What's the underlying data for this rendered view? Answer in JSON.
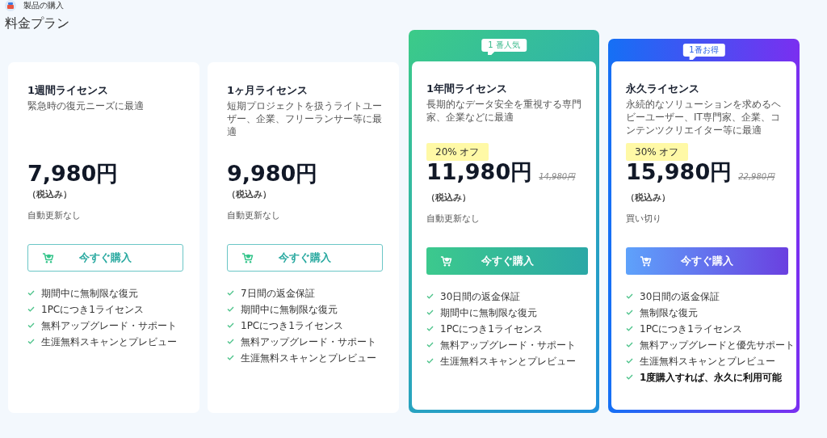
{
  "header": {
    "breadcrumb": "製品の購入",
    "title": "料金プラン"
  },
  "plans": [
    {
      "kind": "plain",
      "name": "1週間ライセンス",
      "description": "緊急時の復元ニーズに最適",
      "price": "7,980円",
      "tax_note": "（税込み）",
      "renewal": "自動更新なし",
      "button": "今すぐ購入",
      "features": [
        {
          "text": "期間中に無制限な復元",
          "bold": false
        },
        {
          "text": "1PCにつき1ライセンス",
          "bold": false
        },
        {
          "text": "無料アップグレード・サポート",
          "bold": false
        },
        {
          "text": "生涯無料スキャンとプレビュー",
          "bold": false
        }
      ]
    },
    {
      "kind": "plain",
      "name": "1ヶ月ライセンス",
      "description": "短期プロジェクトを扱うライトユーザー、企業、フリーランサー等に最適",
      "price": "9,980円",
      "tax_note": "（税込み）",
      "renewal": "自動更新なし",
      "button": "今すぐ購入",
      "features": [
        {
          "text": "7日間の返金保証",
          "bold": false
        },
        {
          "text": "期間中に無制限な復元",
          "bold": false
        },
        {
          "text": "1PCにつき1ライセンス",
          "bold": false
        },
        {
          "text": "無料アップグレード・サポート",
          "bold": false
        },
        {
          "text": "生涯無料スキャンとプレビュー",
          "bold": false
        }
      ]
    },
    {
      "kind": "teal",
      "ribbon": "1 番人気",
      "name": "1年間ライセンス",
      "description": "長期的なデータ安全を重視する専門家、企業などに最適",
      "discount": "20% オフ",
      "price": "11,980円",
      "original_price": "14,980円",
      "tax_note": "（税込み）",
      "renewal": "自動更新なし",
      "button": "今すぐ購入",
      "features": [
        {
          "text": "30日間の返金保証",
          "bold": false
        },
        {
          "text": "期間中に無制限な復元",
          "bold": false
        },
        {
          "text": "1PCにつき1ライセンス",
          "bold": false
        },
        {
          "text": "無料アップグレード・サポート",
          "bold": false
        },
        {
          "text": "生涯無料スキャンとプレビュー",
          "bold": false
        }
      ]
    },
    {
      "kind": "violet",
      "ribbon": "1番お得",
      "name": "永久ライセンス",
      "description": "永続的なソリューションを求めるヘビーユーザー、IT専門家、企業、コンテンツクリエイター等に最適",
      "discount": "30% オフ",
      "price": "15,980円",
      "original_price": "22,980円",
      "tax_note": "（税込み）",
      "renewal": "買い切り",
      "button": "今すぐ購入",
      "features": [
        {
          "text": "30日間の返金保証",
          "bold": false
        },
        {
          "text": "無制限な復元",
          "bold": false
        },
        {
          "text": "1PCにつき1ライセンス",
          "bold": false
        },
        {
          "text": "無料アップグレードと優先サポート",
          "bold": false
        },
        {
          "text": "生涯無料スキャンとプレビュー",
          "bold": false
        },
        {
          "text": "1度購入すれば、永久に利用可能",
          "bold": true
        }
      ]
    }
  ]
}
